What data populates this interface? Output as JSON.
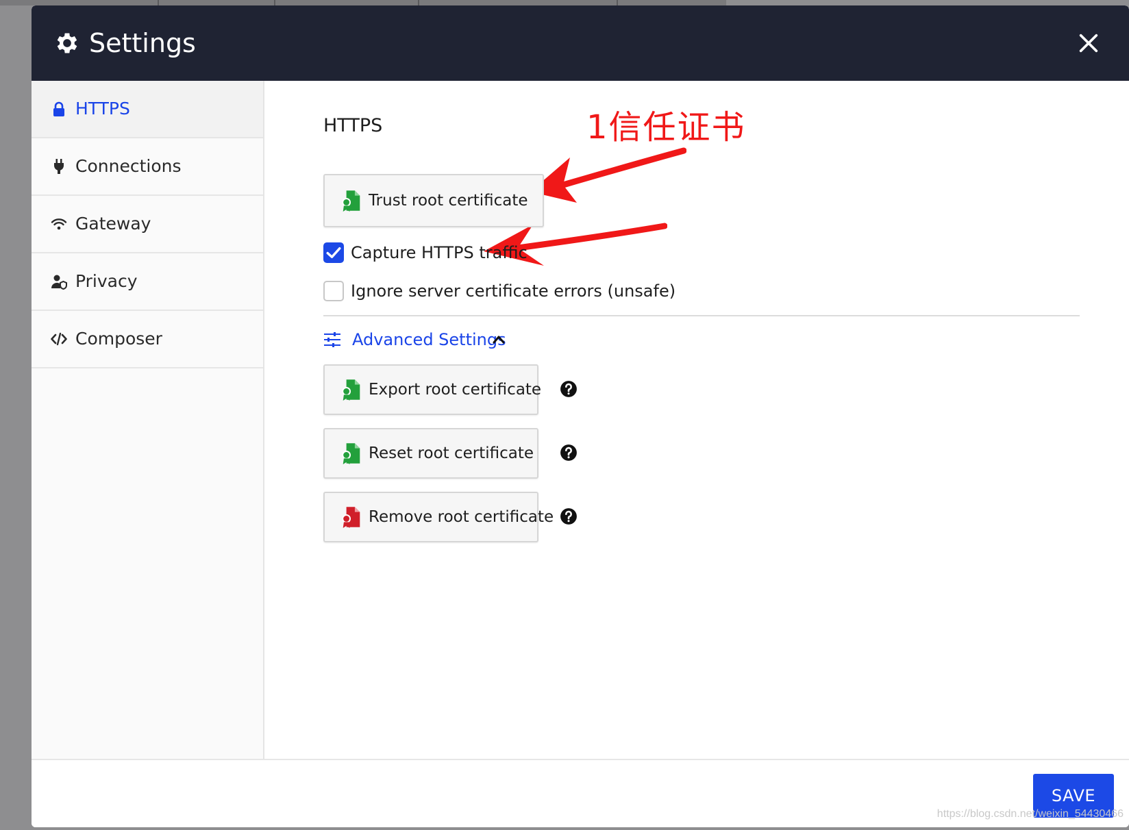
{
  "dialog": {
    "title": "Settings",
    "header_icon": "gear-icon",
    "close_icon": "close-icon"
  },
  "sidebar": {
    "items": [
      {
        "label": "HTTPS",
        "icon": "lock-icon",
        "active": true
      },
      {
        "label": "Connections",
        "icon": "plug-icon",
        "active": false
      },
      {
        "label": "Gateway",
        "icon": "wifi-icon",
        "active": false
      },
      {
        "label": "Privacy",
        "icon": "user-shield-icon",
        "active": false
      },
      {
        "label": "Composer",
        "icon": "code-icon",
        "active": false
      }
    ]
  },
  "main": {
    "section_title": "HTTPS",
    "trust_button": "Trust root certificate",
    "capture_https": {
      "label": "Capture HTTPS traffic",
      "checked": true
    },
    "ignore_errors": {
      "label": "Ignore server certificate errors (unsafe)",
      "checked": false
    },
    "advanced": {
      "label": "Advanced Settings",
      "expanded": true
    },
    "export_button": "Export root certificate",
    "reset_button": "Reset root certificate",
    "remove_button": "Remove root certificate"
  },
  "footer": {
    "save_label": "SAVE"
  },
  "annotation": {
    "text": "1信任证书",
    "color": "#f01818"
  },
  "watermark": "https://blog.csdn.net/weixin_54430466",
  "colors": {
    "header_bg": "#1f2333",
    "accent": "#1c49e6",
    "cert_green": "#23a03c",
    "cert_red": "#d01f2a"
  }
}
